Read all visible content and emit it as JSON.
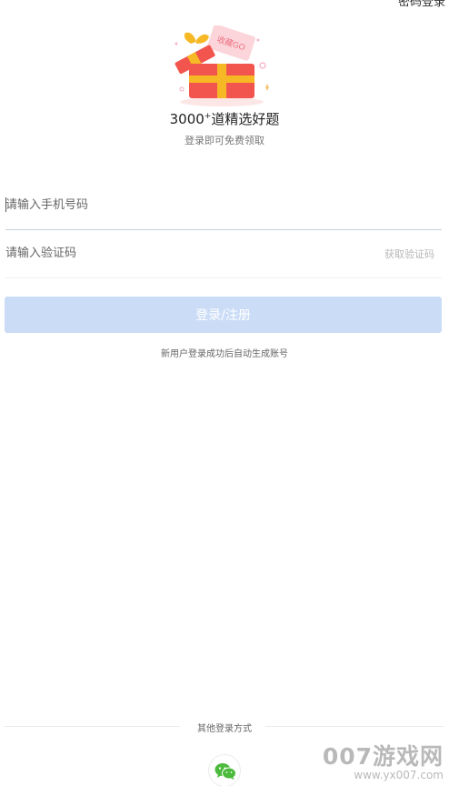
{
  "header": {
    "top_right_link": "密码登录"
  },
  "banner": {
    "gift_tag_text": "收藏GO",
    "headline_number": "3000",
    "headline_sup": "+",
    "headline_text": "道精选好题",
    "subtitle": "登录即可免费领取"
  },
  "form": {
    "phone_placeholder": "请输入手机号码",
    "code_placeholder": "请输入验证码",
    "get_code_label": "获取验证码",
    "submit_label": "登录/注册",
    "note": "新用户登录成功后自动生成账号"
  },
  "other_login": {
    "label": "其他登录方式",
    "wechat_icon": "wechat-icon"
  },
  "watermark": {
    "main": "007游戏网",
    "url": "www.yx007.com"
  },
  "colors": {
    "accent_disabled": "#cbdcf7",
    "gift_red": "#f2554e",
    "ribbon_yellow": "#f7b825",
    "wechat_green": "#4cba3d"
  }
}
